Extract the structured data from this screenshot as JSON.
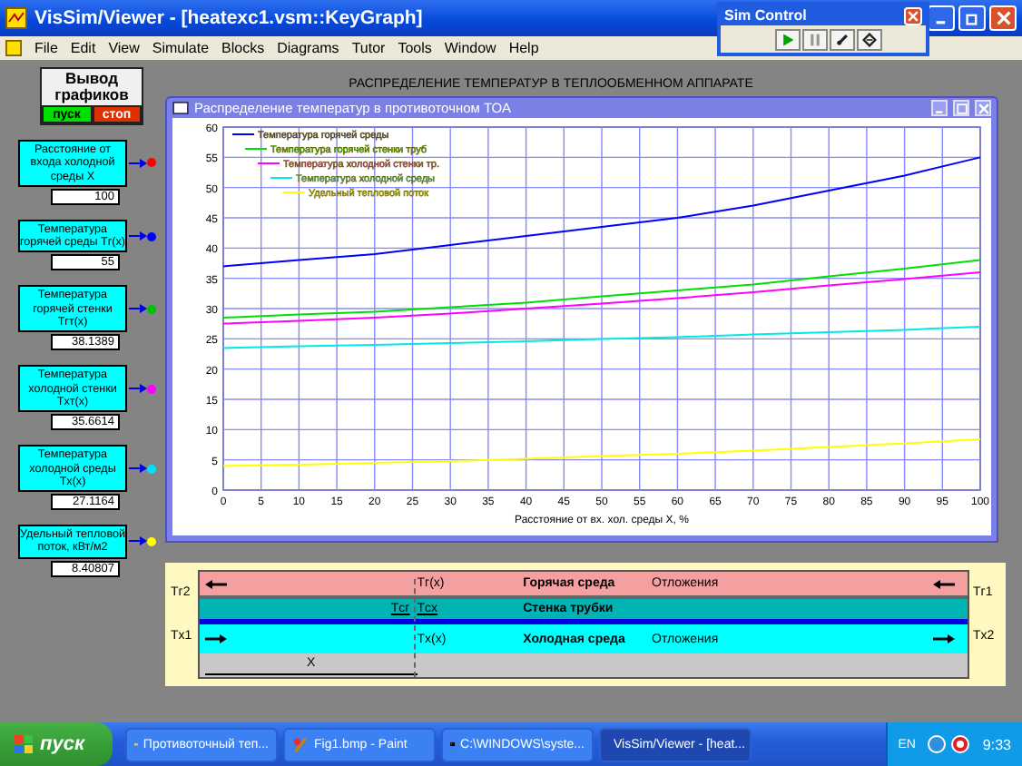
{
  "window": {
    "title": "VisSim/Viewer - [heatexc1.vsm::KeyGraph]"
  },
  "menu": [
    "File",
    "Edit",
    "View",
    "Simulate",
    "Blocks",
    "Diagrams",
    "Tutor",
    "Tools",
    "Window",
    "Help"
  ],
  "sim_control": {
    "title": "Sim Control"
  },
  "output_panel": {
    "title": "Вывод графиков",
    "buttons": [
      {
        "label": "пуск",
        "kind": "start"
      },
      {
        "label": "стоп",
        "kind": "stop"
      }
    ]
  },
  "blocks": [
    {
      "label": "Расстояние от входа холодной среды X",
      "value": "100",
      "color": "#ff0000"
    },
    {
      "label": "Температура горячей среды Tг(x)",
      "value": "55",
      "color": "#0000ff"
    },
    {
      "label": "Температура горячей стенки Tгт(x)",
      "value": "38.1389",
      "color": "#00c000"
    },
    {
      "label": "Температура холодной стенки Tхт(x)",
      "value": "35.6614",
      "color": "#ff00ff"
    },
    {
      "label": "Температура холодной среды Tх(x)",
      "value": "27.1164",
      "color": "#00e0ff"
    },
    {
      "label": "Удельный тепловой поток, кВт/м2",
      "value": "8.40807",
      "color": "#ffff00"
    }
  ],
  "heading": "РАСПРЕДЕЛЕНИЕ ТЕМПЕРАТУР В ТЕПЛООБМЕННОМ АППАРАТЕ",
  "chart_window": {
    "title": "Распределение температур в противоточном ТОА",
    "chart_data": {
      "type": "line",
      "grid": true,
      "legend": true,
      "xlabel": "Расстояние от вх. хол. среды X, %",
      "x": [
        0,
        10,
        20,
        30,
        40,
        50,
        60,
        70,
        80,
        90,
        100
      ],
      "xlim": [
        0,
        100
      ],
      "ylim": [
        0,
        60
      ],
      "xticks": [
        0,
        5,
        10,
        15,
        20,
        25,
        30,
        35,
        40,
        45,
        50,
        55,
        60,
        65,
        70,
        75,
        80,
        85,
        90,
        95,
        100
      ],
      "yticks": [
        0,
        5,
        10,
        15,
        20,
        25,
        30,
        35,
        40,
        45,
        50,
        55,
        60
      ],
      "series": [
        {
          "name": "Температура горячей среды",
          "color": "#0000ff",
          "values": [
            37,
            38,
            39,
            40.5,
            42,
            43.5,
            45,
            47,
            49.5,
            52,
            55
          ]
        },
        {
          "name": "Температура горячей стенки труб",
          "color": "#00e000",
          "values": [
            28.5,
            29,
            29.5,
            30.2,
            31,
            32,
            33,
            34,
            35.3,
            36.6,
            38
          ]
        },
        {
          "name": "Температура холодной стенки тр.",
          "color": "#ff00ff",
          "values": [
            27.5,
            28,
            28.5,
            29.2,
            30,
            30.8,
            31.7,
            32.7,
            33.8,
            34.9,
            36
          ]
        },
        {
          "name": "Температура холодной среды",
          "color": "#00e8e8",
          "values": [
            23.5,
            23.8,
            24,
            24.3,
            24.6,
            25,
            25.3,
            25.7,
            26.1,
            26.5,
            27
          ]
        },
        {
          "name": "Удельный тепловой поток",
          "color": "#ffff00",
          "values": [
            4,
            4.2,
            4.5,
            4.8,
            5.2,
            5.6,
            6,
            6.5,
            7.1,
            7.7,
            8.4
          ]
        }
      ]
    }
  },
  "schematic": {
    "left_labels": [
      "Tг2",
      "Tх1"
    ],
    "right_labels": [
      "Tг1",
      "Tх2"
    ],
    "hot_row": {
      "point": "Tг(x)",
      "name": "Горячая среда",
      "deposit": "Отложения"
    },
    "wall_row": {
      "hot_side": "Tсг",
      "cold_side": "Tсх",
      "name": "Стенка трубки"
    },
    "cold_row": {
      "point": "Tх(x)",
      "name": "Холодная среда",
      "deposit": "Отложения"
    },
    "distance": "X"
  },
  "taskbar": {
    "start": "пуск",
    "items": [
      {
        "label": "Противоточный теп...",
        "kind": "folder",
        "selected": false
      },
      {
        "label": "Fig1.bmp - Paint",
        "kind": "paint",
        "selected": false
      },
      {
        "label": "C:\\WINDOWS\\syste...",
        "kind": "console",
        "selected": false
      },
      {
        "label": "VisSim/Viewer - [heat...",
        "kind": "app",
        "selected": true
      }
    ],
    "language": "EN",
    "clock": "9:33"
  }
}
